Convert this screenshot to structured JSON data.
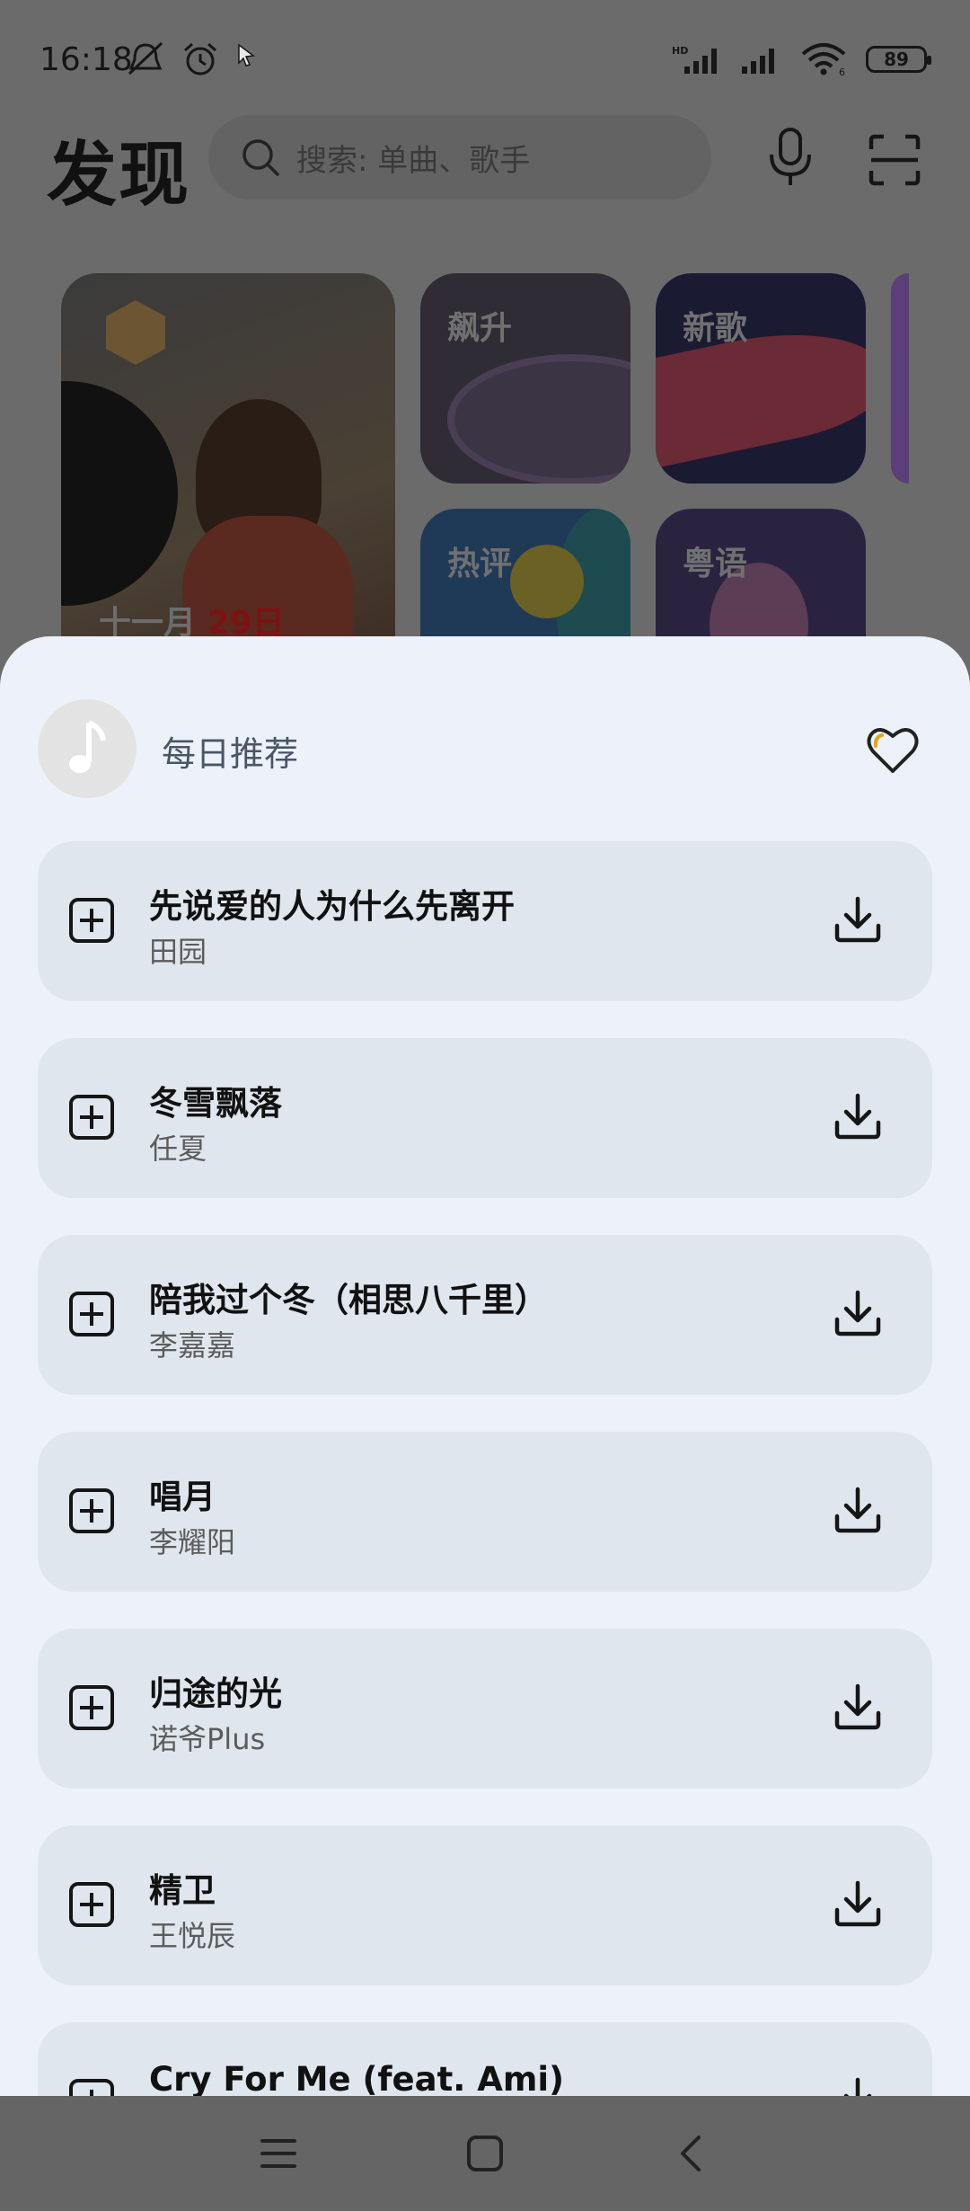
{
  "status_bar": {
    "time": "16:18",
    "battery": "89",
    "network_badge": "HD",
    "wifi_badge": "6"
  },
  "header": {
    "title": "发现",
    "search_placeholder": "搜索: 单曲、歌手"
  },
  "cards": {
    "daily_date_month": "十一月",
    "daily_date_day": "29日",
    "soar": "飙升",
    "new_songs": "新歌",
    "hot_comments": "热评",
    "cantonese": "粤语"
  },
  "sheet": {
    "title": "每日推荐",
    "songs": [
      {
        "title": "先说爱的人为什么先离开",
        "artist": "田园"
      },
      {
        "title": "冬雪飘落",
        "artist": "任夏"
      },
      {
        "title": "陪我过个冬（相思八千里）",
        "artist": "李嘉嘉"
      },
      {
        "title": "唱月",
        "artist": "李耀阳"
      },
      {
        "title": "归途的光",
        "artist": "诺爷Plus"
      },
      {
        "title": "精卫",
        "artist": "王悦辰"
      },
      {
        "title": "Cry For Me (feat. Ami)",
        "artist": ""
      }
    ]
  },
  "icons": {
    "status": [
      "mute-icon",
      "alarm-icon",
      "cursor-icon",
      "signal-icon",
      "wifi-icon",
      "battery-icon"
    ],
    "header": [
      "search-icon",
      "microphone-icon",
      "scan-icon"
    ],
    "sheet": [
      "music-note-icon",
      "heart-icon",
      "add-to-list-icon",
      "download-icon"
    ],
    "nav": [
      "menu-icon",
      "home-icon",
      "back-icon"
    ]
  }
}
